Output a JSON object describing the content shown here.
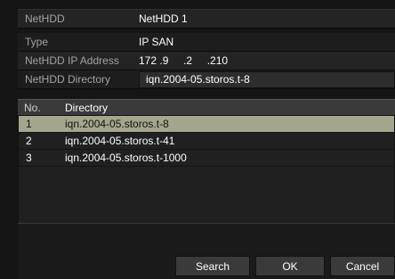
{
  "panel": {
    "netHDD_label": "NetHDD",
    "netHDD_value": "NetHDD 1",
    "type_label": "Type",
    "type_value": "IP SAN",
    "ip_label": "NetHDD IP Address",
    "ip_value": "172 .9     .2     .210",
    "dir_label": "NetHDD Directory",
    "dir_value": "iqn.2004-05.storos.t-8"
  },
  "table": {
    "headers": {
      "no": "No.",
      "directory": "Directory"
    },
    "rows": [
      {
        "no": "1",
        "directory": "iqn.2004-05.storos.t-8"
      },
      {
        "no": "2",
        "directory": "iqn.2004-05.storos.t-41"
      },
      {
        "no": "3",
        "directory": "iqn.2004-05.storos.t-1000"
      }
    ]
  },
  "buttons": {
    "search": "Search",
    "ok": "OK",
    "cancel": "Cancel"
  },
  "colors": {
    "selection": "#a6a58d",
    "header": "#3a3a3a",
    "background": "#151515"
  }
}
